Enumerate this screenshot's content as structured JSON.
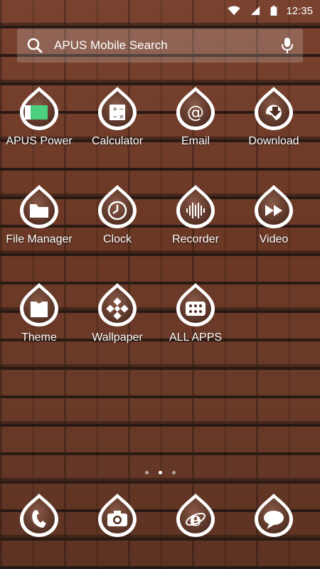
{
  "status_bar": {
    "time": "12:35",
    "icons": [
      "wifi-icon",
      "signal-icon",
      "battery-icon"
    ]
  },
  "search": {
    "placeholder": "APUS Mobile Search",
    "icons": [
      "search-icon",
      "microphone-icon"
    ]
  },
  "apps": [
    {
      "label": "APUS Power",
      "icon": "apus-power-icon"
    },
    {
      "label": "Calculator",
      "icon": "calculator-icon"
    },
    {
      "label": "Email",
      "icon": "email-icon"
    },
    {
      "label": "Download",
      "icon": "download-icon"
    },
    {
      "label": "File Manager",
      "icon": "folder-icon"
    },
    {
      "label": "Clock",
      "icon": "clock-icon"
    },
    {
      "label": "Recorder",
      "icon": "recorder-icon"
    },
    {
      "label": "Video",
      "icon": "video-icon"
    },
    {
      "label": "Theme",
      "icon": "theme-shirt-icon"
    },
    {
      "label": "Wallpaper",
      "icon": "wallpaper-icon"
    },
    {
      "label": "ALL APPS",
      "icon": "all-apps-icon"
    }
  ],
  "page_indicator": {
    "count": 3,
    "active_index": 1
  },
  "dock": [
    {
      "icon": "phone-icon"
    },
    {
      "icon": "camera-icon"
    },
    {
      "icon": "browser-icon"
    },
    {
      "icon": "messaging-icon"
    }
  ],
  "colors": {
    "icon_outline": "#ffffff",
    "icon_fill": "#6b3f30",
    "apus_power_accent": "#4cd07d"
  }
}
